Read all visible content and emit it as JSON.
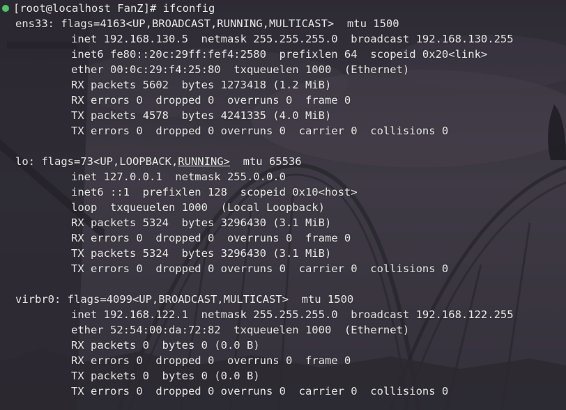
{
  "terminal": {
    "prompt": "[root@localhost FanZ]# ifconfig",
    "status_color": "#4cc76a",
    "ens33": {
      "header": "ens33: flags=4163<UP,BROADCAST,RUNNING,MULTICAST>  mtu 1500",
      "inet": "inet 192.168.130.5  netmask 255.255.255.0  broadcast 192.168.130.255",
      "inet6": "inet6 fe80::20c:29ff:fef4:2580  prefixlen 64  scopeid 0x20<link>",
      "ether": "ether 00:0c:29:f4:25:80  txqueuelen 1000  (Ethernet)",
      "rx_packets": "RX packets 5602  bytes 1273418 (1.2 MiB)",
      "rx_errors": "RX errors 0  dropped 0  overruns 0  frame 0",
      "tx_packets": "TX packets 4578  bytes 4241335 (4.0 MiB)",
      "tx_errors": "TX errors 0  dropped 0 overruns 0  carrier 0  collisions 0"
    },
    "lo": {
      "header_prefix": "lo: flags=73<UP,LOOPBACK,",
      "header_underlined": "RUNNING>",
      "header_suffix": "  mtu 65536",
      "inet": "inet 127.0.0.1  netmask 255.0.0.0",
      "inet6": "inet6 ::1  prefixlen 128  scopeid 0x10<host>",
      "loop": "loop  txqueuelen 1000  (Local Loopback)",
      "rx_packets": "RX packets 5324  bytes 3296430 (3.1 MiB)",
      "rx_errors": "RX errors 0  dropped 0  overruns 0  frame 0",
      "tx_packets": "TX packets 5324  bytes 3296430 (3.1 MiB)",
      "tx_errors": "TX errors 0  dropped 0 overruns 0  carrier 0  collisions 0"
    },
    "virbr0": {
      "header": "virbr0: flags=4099<UP,BROADCAST,MULTICAST>  mtu 1500",
      "inet": "inet 192.168.122.1  netmask 255.255.255.0  broadcast 192.168.122.255",
      "ether": "ether 52:54:00:da:72:82  txqueuelen 1000  (Ethernet)",
      "rx_packets": "RX packets 0  bytes 0 (0.0 B)",
      "rx_errors": "RX errors 0  dropped 0  overruns 0  frame 0",
      "tx_packets": "TX packets 0  bytes 0 (0.0 B)",
      "tx_errors": "TX errors 0  dropped 0 overruns 0  carrier 0  collisions 0"
    }
  }
}
